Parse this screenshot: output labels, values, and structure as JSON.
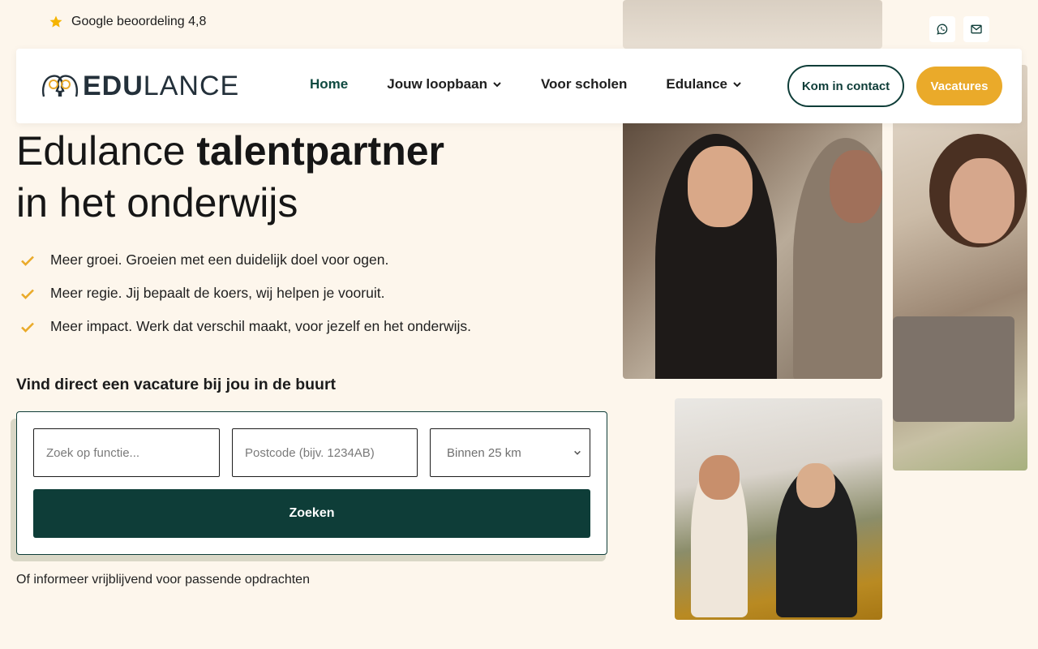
{
  "topbar": {
    "rating_text": "Google beoordeling 4,8",
    "star_icon": "star-icon"
  },
  "contact_icons": [
    {
      "icon": "whatsapp-icon"
    },
    {
      "icon": "mail-icon"
    }
  ],
  "brand": {
    "logo_bold": "EDU",
    "logo_light": "LANCE"
  },
  "nav": {
    "items": [
      {
        "label": "Home",
        "active": true,
        "dropdown": false
      },
      {
        "label": "Jouw loopbaan",
        "active": false,
        "dropdown": true
      },
      {
        "label": "Voor scholen",
        "active": false,
        "dropdown": false
      },
      {
        "label": "Edulance",
        "active": false,
        "dropdown": true
      }
    ],
    "contact_button": "Kom in contact",
    "vacatures_button": "Vacatures"
  },
  "hero": {
    "title_part1": "Edulance ",
    "title_part2": "talentpartner",
    "title_part3": "in het onderwijs",
    "benefits": [
      "Meer groei. Groeien met een duidelijk doel voor ogen.",
      "Meer regie. Jij bepaalt de koers, wij helpen je vooruit.",
      "Meer impact. Werk dat verschil maakt, voor jezelf en het onderwijs."
    ]
  },
  "search": {
    "heading": "Vind direct een vacature bij jou in de buurt",
    "function_placeholder": "Zoek op functie...",
    "postcode_placeholder": "Postcode (bijv. 1234AB)",
    "radius_selected": "Binnen 25 km",
    "submit_label": "Zoeken"
  },
  "info_text": "Of informeer vrijblijvend voor passende opdrachten",
  "colors": {
    "background": "#fdf6ec",
    "primary": "#0e3d38",
    "accent": "#eaaa2a"
  }
}
